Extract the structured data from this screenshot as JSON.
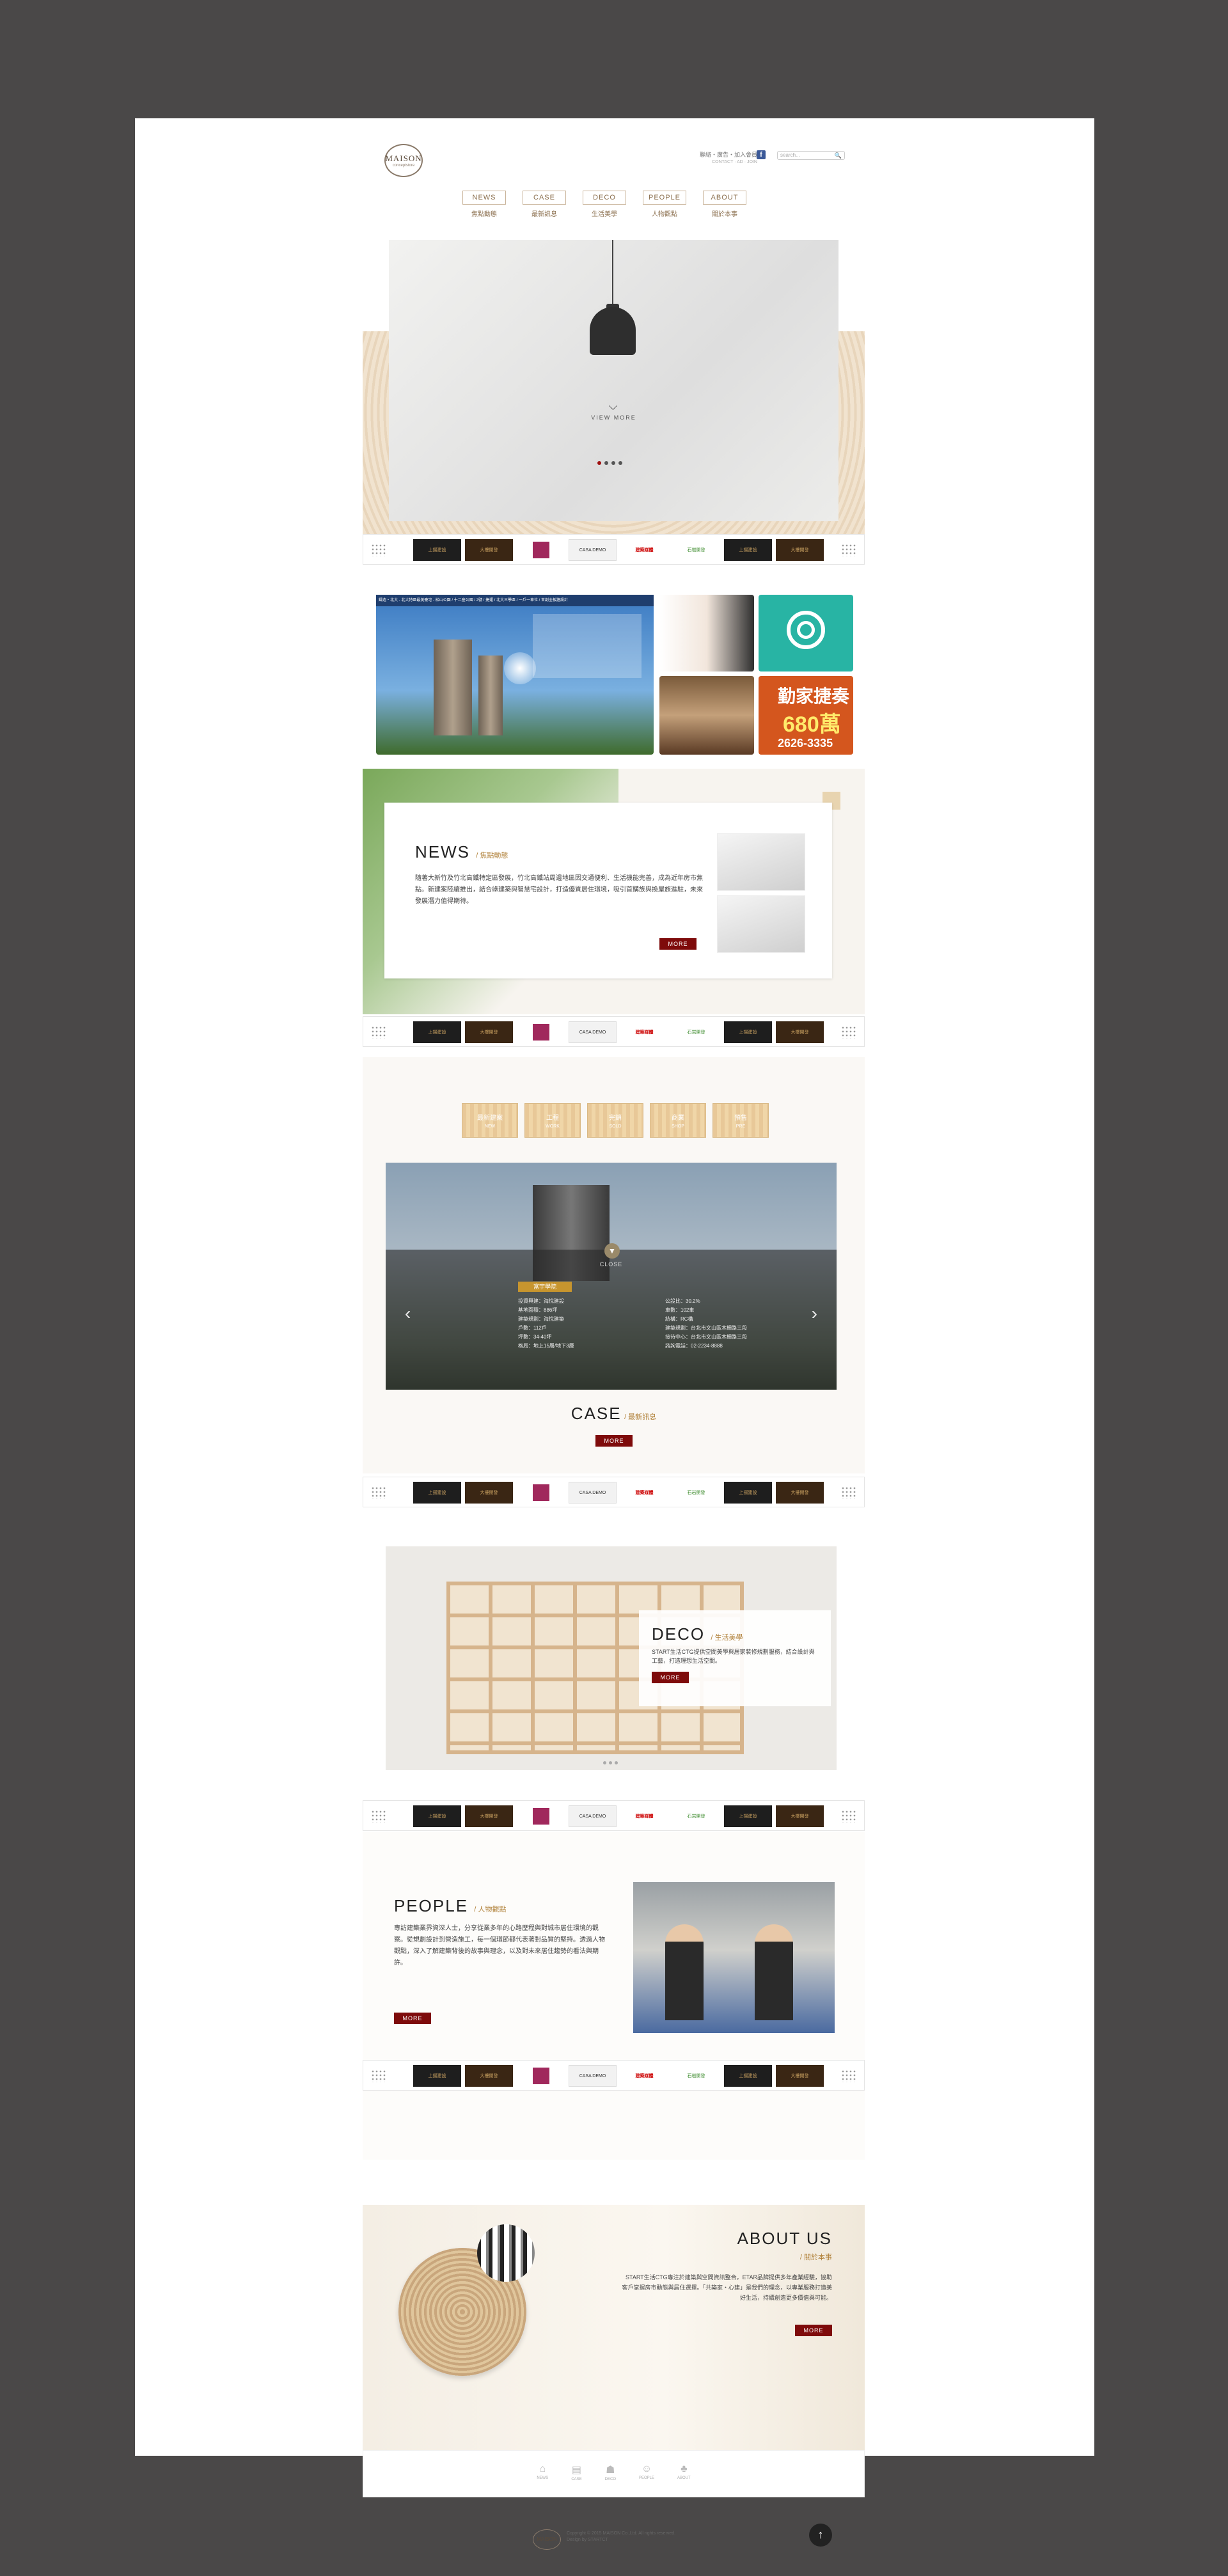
{
  "header": {
    "logo_text": "MAISON",
    "logo_sub": "conceptstore",
    "toplinks": "聯絡・廣告・加入會員",
    "toplinks_sub": "CONTACT · AD · JOIN",
    "fb": "f",
    "search_placeholder": "search...",
    "search_icon": "🔍"
  },
  "nav": [
    {
      "en": "NEWS",
      "zh": "焦點動態"
    },
    {
      "en": "CASE",
      "zh": "最新訊息"
    },
    {
      "en": "DECO",
      "zh": "生活美學"
    },
    {
      "en": "PEOPLE",
      "zh": "人物觀點"
    },
    {
      "en": "ABOUT",
      "zh": "關於本事"
    }
  ],
  "hero": {
    "view_more": "VIEW MORE",
    "chevron": "⌵"
  },
  "partners": [
    "上揚建設",
    "大樓開發",
    "",
    "CASA DEMO",
    "建築媒體",
    "石岩開發",
    "上揚建設",
    "大樓開發"
  ],
  "ads": {
    "big_bar": "鑄造・北大 - 北大特區最美豪宅 - 松山公園 / 十二座公園 / 2號 / 捷運 / 北大三學區 / 一戶一車位 / 首創全板牆設計",
    "t1": "勤家捷奏",
    "t2": "680萬",
    "t3": "2626-3335"
  },
  "news": {
    "title": "NEWS",
    "title_zh": "/ 焦點動態",
    "text": "隨著大新竹及竹北高鐵特定區發展，竹北高鐵站周邊地區因交通便利、生活機能完善，成為近年房市焦點。新建案陸續推出，結合綠建築與智慧宅設計，打造優質居住環境，吸引首購族與換屋族進駐，未來發展潛力值得期待。",
    "more": "MORE"
  },
  "case": {
    "tabs": [
      {
        "label": "最新建案",
        "sub": "NEW"
      },
      {
        "label": "工程",
        "sub": "WORK"
      },
      {
        "label": "完銷",
        "sub": "SOLD"
      },
      {
        "label": "商業",
        "sub": "SHOP"
      },
      {
        "label": "預售",
        "sub": "PRE"
      }
    ],
    "close": "CLOSE",
    "label": "富宇學院",
    "specs": [
      "投資興建：海悅建設",
      "公設比：30.2%",
      "基地面積：886坪",
      "車數：102車",
      "建築規劃：海悅建築",
      "結構：RC構",
      "戶數：112戶",
      "建築規劃：台北市文山區木柵路三段",
      "坪數：34-40坪",
      "接待中心：台北市文山區木柵路三段",
      "格局：地上15層/地下3層",
      "諮詢電話：02-2234-8888"
    ],
    "prev": "‹",
    "next": "›",
    "title": "CASE",
    "title_zh": "/ 最新訊息",
    "more": "MORE"
  },
  "deco": {
    "title": "DECO",
    "title_zh": "/ 生活美學",
    "text": "START生活CTG提供空間美學與居家裝修規劃服務，結合設計與工藝，打造理想生活空間。",
    "more": "MORE"
  },
  "people": {
    "title": "PEOPLE",
    "title_zh": "/ 人物觀點",
    "text": "專訪建築業界資深人士，分享從業多年的心路歷程與對城市居住環境的觀察。從規劃設計到營造施工，每一個環節都代表著對品質的堅持。透過人物觀點，深入了解建築背後的故事與理念，以及對未來居住趨勢的看法與期許。",
    "more": "MORE"
  },
  "about": {
    "title": "ABOUT US",
    "title_zh": "/ 關於本事",
    "text": "START生活CTG專注於建築與空間資訊整合，ETAR品牌提供多年產業經驗，協助客戶掌握房市動態與居住選擇。「共築家・心建」是我們的理念，以專業服務打造美好生活，持續創造更多價值與可能。",
    "more": "MORE"
  },
  "footnav": [
    {
      "icon": "⌂",
      "label": "NEWS"
    },
    {
      "icon": "▤",
      "label": "CASE"
    },
    {
      "icon": "☗",
      "label": "DECO"
    },
    {
      "icon": "☺",
      "label": "PEOPLE"
    },
    {
      "icon": "♣",
      "label": "ABOUT"
    }
  ],
  "footer": {
    "logo": "MAISON",
    "copy1": "Copyright © 2015 MAISON Co.,Ltd. All rights reserved.",
    "copy2": "Design by STARTCT",
    "totop": "↑"
  },
  "colors": {
    "accent": "#7e0b0b",
    "gold": "#b08038",
    "nav": "#8b6f4e"
  }
}
